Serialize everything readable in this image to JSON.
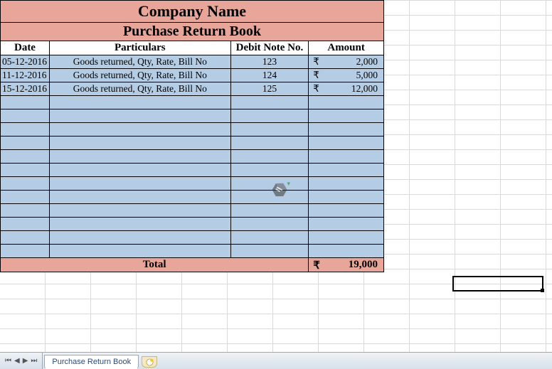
{
  "sheet": {
    "title": "Company Name",
    "subtitle": "Purchase Return Book",
    "headers": {
      "date": "Date",
      "particulars": "Particulars",
      "debit": "Debit Note No.",
      "amount": "Amount"
    },
    "currency": "₹",
    "rows": [
      {
        "date": "05-12-2016",
        "particulars": "Goods returned, Qty, Rate, Bill No",
        "debit": "123",
        "amount": "2,000"
      },
      {
        "date": "11-12-2016",
        "particulars": "Goods returned, Qty, Rate, Bill No",
        "debit": "124",
        "amount": "5,000"
      },
      {
        "date": "15-12-2016",
        "particulars": "Goods returned, Qty, Rate, Bill No",
        "debit": "125",
        "amount": "12,000"
      },
      {
        "date": "",
        "particulars": "",
        "debit": "",
        "amount": ""
      },
      {
        "date": "",
        "particulars": "",
        "debit": "",
        "amount": ""
      },
      {
        "date": "",
        "particulars": "",
        "debit": "",
        "amount": ""
      },
      {
        "date": "",
        "particulars": "",
        "debit": "",
        "amount": ""
      },
      {
        "date": "",
        "particulars": "",
        "debit": "",
        "amount": ""
      },
      {
        "date": "",
        "particulars": "",
        "debit": "",
        "amount": ""
      },
      {
        "date": "",
        "particulars": "",
        "debit": "",
        "amount": ""
      },
      {
        "date": "",
        "particulars": "",
        "debit": "",
        "amount": ""
      },
      {
        "date": "",
        "particulars": "",
        "debit": "",
        "amount": ""
      },
      {
        "date": "",
        "particulars": "",
        "debit": "",
        "amount": ""
      },
      {
        "date": "",
        "particulars": "",
        "debit": "",
        "amount": ""
      },
      {
        "date": "",
        "particulars": "",
        "debit": "",
        "amount": ""
      }
    ],
    "total_label": "Total",
    "total_amount": "19,000"
  },
  "tabbar": {
    "active_tab": "Purchase Return Book"
  }
}
